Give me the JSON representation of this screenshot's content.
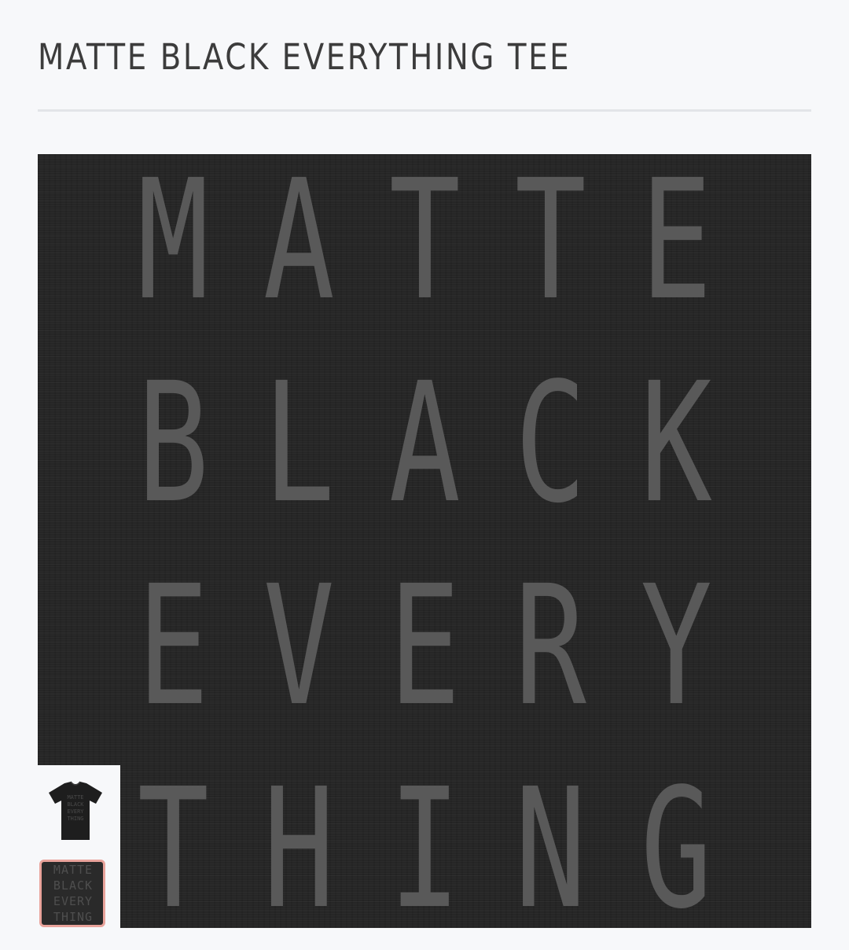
{
  "product": {
    "title": "MATTE BLACK EVERYTHING TEE"
  },
  "design": {
    "rows": [
      [
        "M",
        "A",
        "T",
        "T",
        "E"
      ],
      [
        "B",
        "L",
        "A",
        "C",
        "K"
      ],
      [
        "E",
        "V",
        "E",
        "R",
        "Y"
      ],
      [
        "T",
        "H",
        "I",
        "N",
        "G"
      ]
    ],
    "mini_rows": [
      "MATTE",
      "BLACK",
      "EVERY",
      "THING"
    ]
  },
  "gallery": {
    "thumbnails": [
      {
        "name": "tee-front",
        "selected": false
      },
      {
        "name": "design-closeup",
        "selected": true
      }
    ]
  },
  "colors": {
    "background": "#f7f8fa",
    "fabric": "#262626",
    "print": "#595959",
    "selected_border": "#e9a39b"
  }
}
